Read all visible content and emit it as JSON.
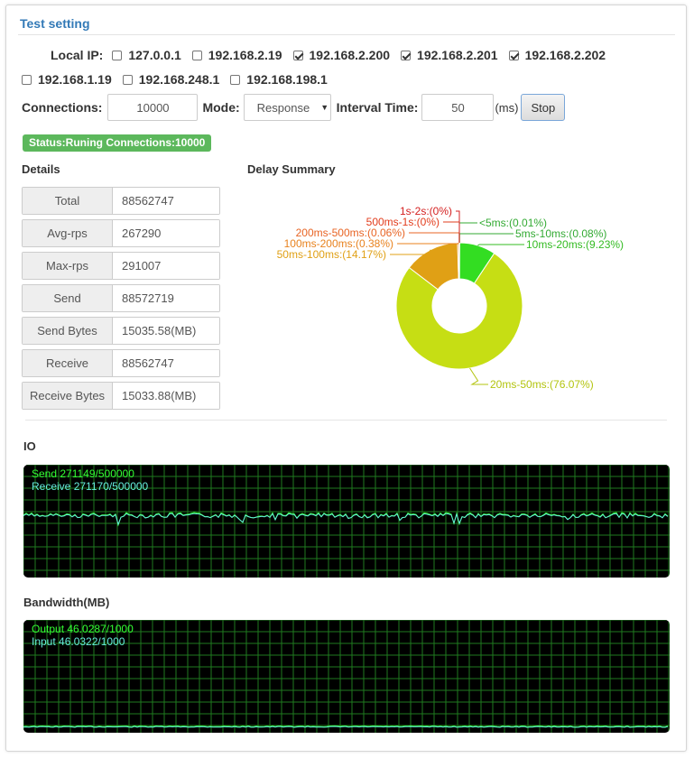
{
  "panel": {
    "title": "Test setting"
  },
  "local_ip": {
    "label": "Local IP:",
    "options": [
      {
        "ip": "127.0.0.1",
        "checked": false
      },
      {
        "ip": "192.168.2.19",
        "checked": false
      },
      {
        "ip": "192.168.2.200",
        "checked": true
      },
      {
        "ip": "192.168.2.201",
        "checked": true
      },
      {
        "ip": "192.168.2.202",
        "checked": true
      },
      {
        "ip": "192.168.1.19",
        "checked": false
      },
      {
        "ip": "192.168.248.1",
        "checked": false
      },
      {
        "ip": "192.168.198.1",
        "checked": false
      }
    ]
  },
  "config": {
    "connections_label": "Connections:",
    "connections_value": "10000",
    "mode_label": "Mode:",
    "mode_value": "Response",
    "interval_label": "Interval Time:",
    "interval_value": "50",
    "interval_unit": "(ms)",
    "stop_label": "Stop"
  },
  "status": {
    "text": "Status:Runing Connections:10000",
    "color": "#5cb85c"
  },
  "details": {
    "title": "Details",
    "rows": [
      {
        "key": "Total",
        "value": "88562747"
      },
      {
        "key": "Avg-rps",
        "value": "267290"
      },
      {
        "key": "Max-rps",
        "value": "291007"
      },
      {
        "key": "Send",
        "value": "88572719"
      },
      {
        "key": "Send Bytes",
        "value": "15035.58(MB)"
      },
      {
        "key": "Receive",
        "value": "88562747"
      },
      {
        "key": "Receive Bytes",
        "value": "15033.88(MB)"
      }
    ]
  },
  "delay": {
    "title": "Delay Summary",
    "chart_data": {
      "type": "pie",
      "categories": [
        "<5ms",
        "5ms-10ms",
        "10ms-20ms",
        "20ms-50ms",
        "50ms-100ms",
        "100ms-200ms",
        "200ms-500ms",
        "500ms-1s",
        "1s-2s"
      ],
      "values": [
        0.01,
        0.08,
        9.23,
        76.07,
        14.17,
        0.38,
        0.06,
        0,
        0
      ],
      "labels": [
        "<5ms:(0.01%)",
        "5ms-10ms:(0.08%)",
        "10ms-20ms:(9.23%)",
        "20ms-50ms:(76.07%)",
        "50ms-100ms:(14.17%)",
        "100ms-200ms:(0.38%)",
        "200ms-500ms:(0.06%)",
        "500ms-1s:(0%)",
        "1s-2s:(0%)"
      ],
      "colors": [
        "#33cc00",
        "#33cc00",
        "#33dd22",
        "#c6de14",
        "#e0a015",
        "#e8821e",
        "#e86424",
        "#e23c1c",
        "#d42020"
      ],
      "label_colors": [
        "#33aa33",
        "#33aa33",
        "#33bb22",
        "#b3c40e",
        "#e0a015",
        "#e8821e",
        "#e86424",
        "#e23c1c",
        "#d42020"
      ]
    }
  },
  "io": {
    "title": "IO",
    "send_text": "Send 271149/500000",
    "receive_text": "Receive 271170/500000",
    "send_color": "#33ff33",
    "receive_color": "#66eedd"
  },
  "bandwidth": {
    "title": "Bandwidth(MB)",
    "output_text": "Output 46.0287/1000",
    "input_text": "Input 46.0322/1000",
    "output_color": "#33ff33",
    "input_color": "#66eedd"
  }
}
